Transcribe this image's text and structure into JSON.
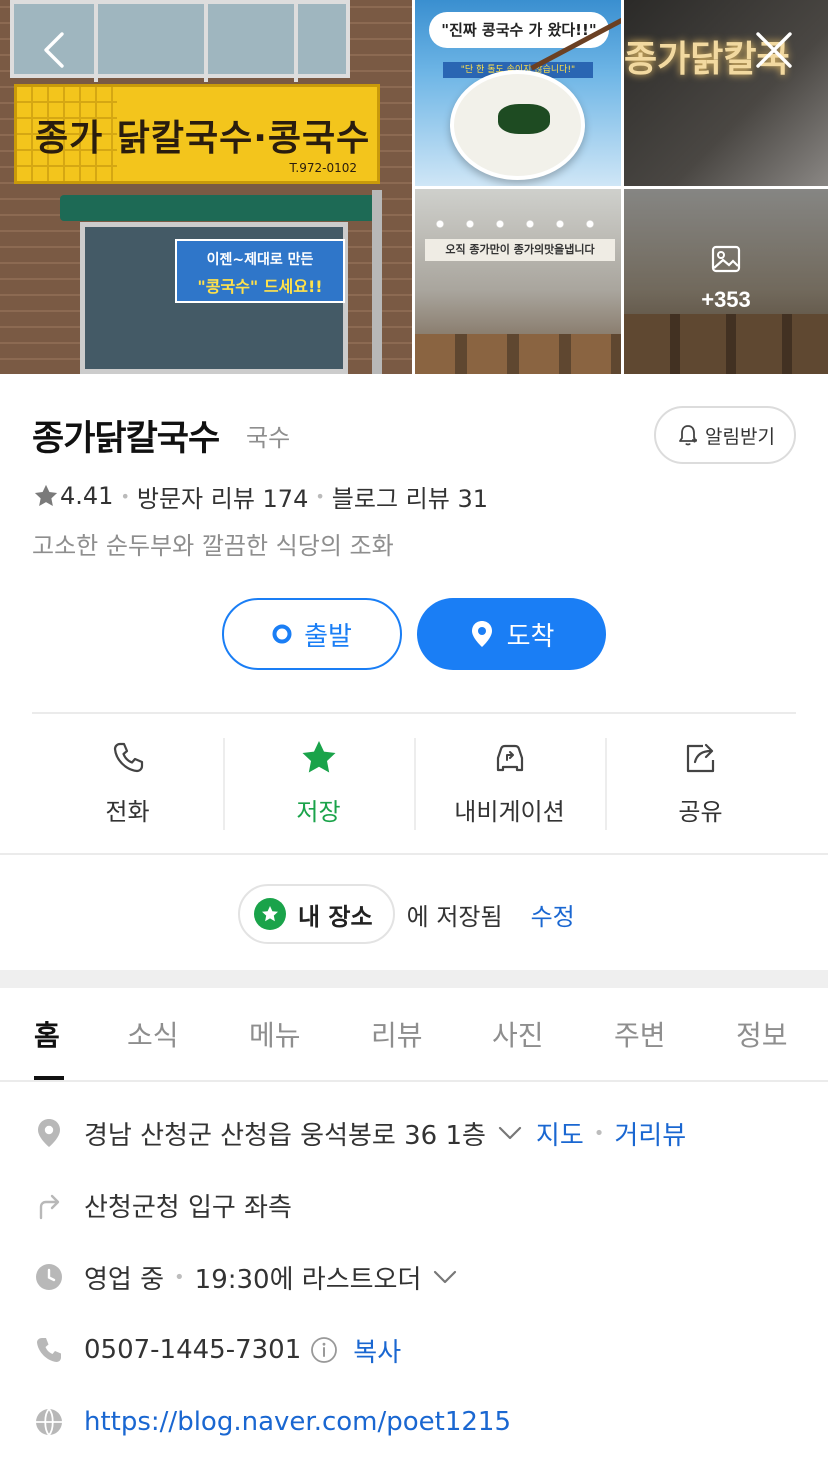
{
  "photos": {
    "storefront_sign": "종가 닭칼국수·콩국수",
    "storefront_phone": "T.972-0102",
    "storefront_poster_line1": "이젠~제대로 만든",
    "storefront_poster_line2": "\"콩국수\" 드세요!!",
    "bowl_title": "\"진짜 콩국수 가 왔다!!\"",
    "bowl_subtitle": "\"단 한 톨도 속이지 않습니다!\"",
    "wall_sign": "종가닭칼국",
    "interior_banner": "오직 종가만이 종가의맛을냅니다",
    "more_count": "+353"
  },
  "header": {
    "back_icon": "chevron-left-icon",
    "close_icon": "close-icon"
  },
  "place": {
    "name": "종가닭칼국수",
    "category": "국수",
    "notify_label": "알림받기",
    "rating": "4.41",
    "visitor_reviews": "방문자 리뷰 174",
    "blog_reviews": "블로그 리뷰 31",
    "description": "고소한 순두부와 깔끔한 식당의 조화"
  },
  "route": {
    "start_label": "출발",
    "arrive_label": "도착"
  },
  "actions": {
    "call": "전화",
    "save": "저장",
    "navigation": "내비게이션",
    "share": "공유"
  },
  "saved": {
    "folder": "내 장소",
    "text": "에 저장됨",
    "edit": "수정"
  },
  "tabs": [
    "홈",
    "소식",
    "메뉴",
    "리뷰",
    "사진",
    "주변",
    "정보"
  ],
  "info": {
    "address": "경남 산청군 산청읍 웅석봉로 36 1층",
    "map_link": "지도",
    "street_view_link": "거리뷰",
    "directions": "산청군청 입구 좌측",
    "status": "영업 중",
    "last_order": "19:30에 라스트오더",
    "phone": "0507-1445-7301",
    "copy": "복사",
    "website": "https://blog.naver.com/poet1215"
  },
  "colors": {
    "accent_blue": "#1a7ef5",
    "link_blue": "#1a67d1",
    "saved_green": "#1aa34a"
  }
}
